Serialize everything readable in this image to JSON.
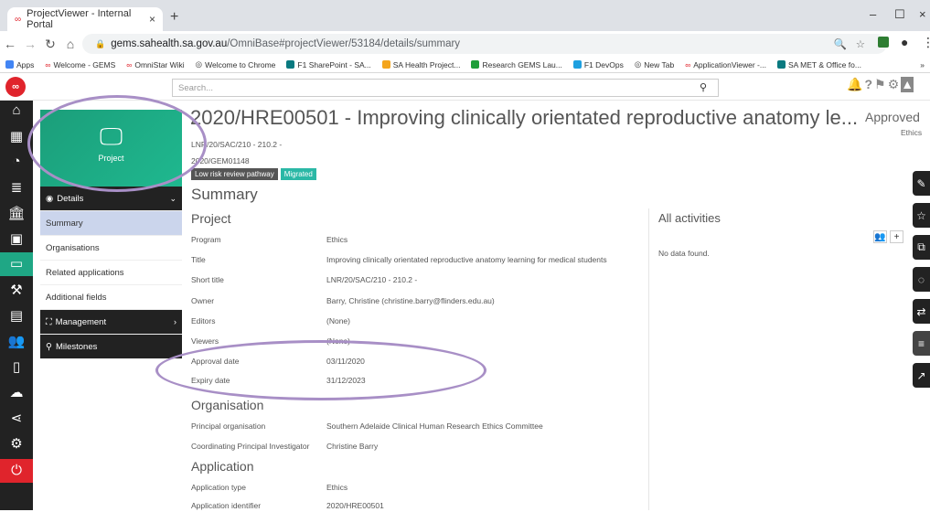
{
  "browser": {
    "tab_title": "ProjectViewer - Internal Portal",
    "new_tab": "+",
    "url_domain": "gems.sahealth.sa.gov.au",
    "url_path": "/OmniBase#projectViewer/53184/details/summary",
    "bookmarks": [
      "Apps",
      "Welcome - GEMS",
      "OmniStar Wiki",
      "Welcome to Chrome",
      "F1 SharePoint - SA...",
      "SA Health Project...",
      "Research GEMS Lau...",
      "F1 DevOps",
      "New Tab",
      "ApplicationViewer -...",
      "SA MET & Office fo..."
    ],
    "more": "»"
  },
  "app": {
    "search_placeholder": "Search...",
    "tile_label": "Project",
    "title": "2020/HRE00501 - Improving clinically orientated reproductive anatomy le...",
    "status": "Approved",
    "status_sub": "Ethics",
    "meta1": "LNR/20/SAC/210 - 210.2 -",
    "meta2": "2020/GEM01148",
    "badge1": "Low risk review pathway",
    "badge2": "Migrated"
  },
  "menu": {
    "details": "Details",
    "summary": "Summary",
    "organisations": "Organisations",
    "related": "Related applications",
    "additional": "Additional fields",
    "management": "Management",
    "milestones": "Milestones"
  },
  "summary": {
    "heading": "Summary",
    "project_heading": "Project",
    "project_rows": [
      {
        "k": "Program",
        "v": "Ethics"
      },
      {
        "k": "Title",
        "v": "Improving clinically orientated reproductive anatomy learning for medical students"
      },
      {
        "k": "Short title",
        "v": "LNR/20/SAC/210 - 210.2 -"
      },
      {
        "k": "Owner",
        "v": "Barry, Christine (christine.barry@flinders.edu.au)"
      },
      {
        "k": "Editors",
        "v": "(None)"
      },
      {
        "k": "Viewers",
        "v": "(None)"
      },
      {
        "k": "Approval date",
        "v": "03/11/2020"
      },
      {
        "k": "Expiry date",
        "v": "31/12/2023"
      }
    ],
    "org_heading": "Organisation",
    "org_rows": [
      {
        "k": "Principal organisation",
        "v": "Southern Adelaide Clinical Human Research Ethics Committee"
      },
      {
        "k": "Coordinating Principal Investigator",
        "v": "Christine Barry"
      }
    ],
    "app_heading": "Application",
    "app_rows": [
      {
        "k": "Application type",
        "v": "Ethics"
      },
      {
        "k": "Application identifier",
        "v": "2020/HRE00501"
      }
    ]
  },
  "activities": {
    "heading": "All activities",
    "empty": "No data found."
  }
}
